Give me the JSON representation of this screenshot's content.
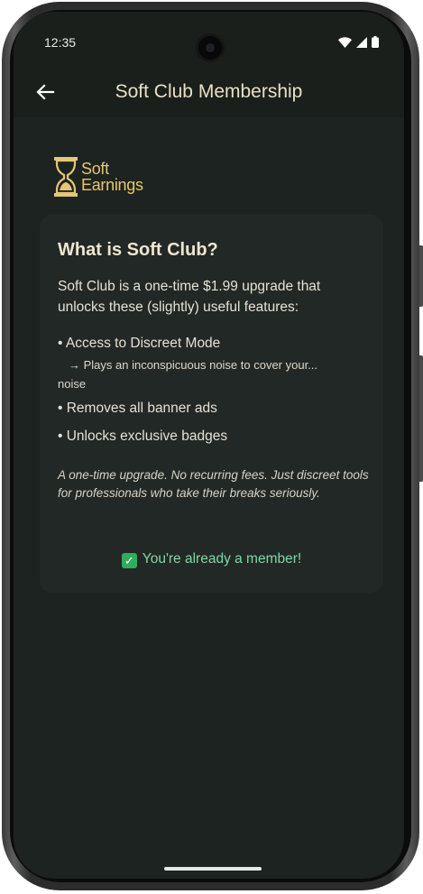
{
  "status_bar": {
    "time": "12:35",
    "icons": [
      "wifi-icon",
      "signal-icon",
      "battery-icon"
    ]
  },
  "app_bar": {
    "back_icon": "arrow-left-icon",
    "title": "Soft Club Membership"
  },
  "logo": {
    "icon": "hourglass-icon",
    "line1": "Soft",
    "line2": "Earnings",
    "color": "#e5c675"
  },
  "card": {
    "title": "What is Soft Club?",
    "intro": "Soft Club is a one-time $1.99 upgrade that unlocks these (slightly) useful features:",
    "features": [
      "• Access to Discreet Mode",
      "• Removes all banner ads",
      "• Unlocks exclusive badges"
    ],
    "feature_sub": "→ Plays an inconspicuous noise to cover your...",
    "feature_sub_cont": "noise",
    "note": "A one-time upgrade. No recurring fees. Just discreet tools for professionals who take their breaks seriously.",
    "member_check": "✓",
    "member_status": "You're already a member!",
    "member_color": "#7fd7a6"
  },
  "colors": {
    "background": "#1d2320",
    "card": "#222825",
    "title_text": "#e9dfc6"
  }
}
